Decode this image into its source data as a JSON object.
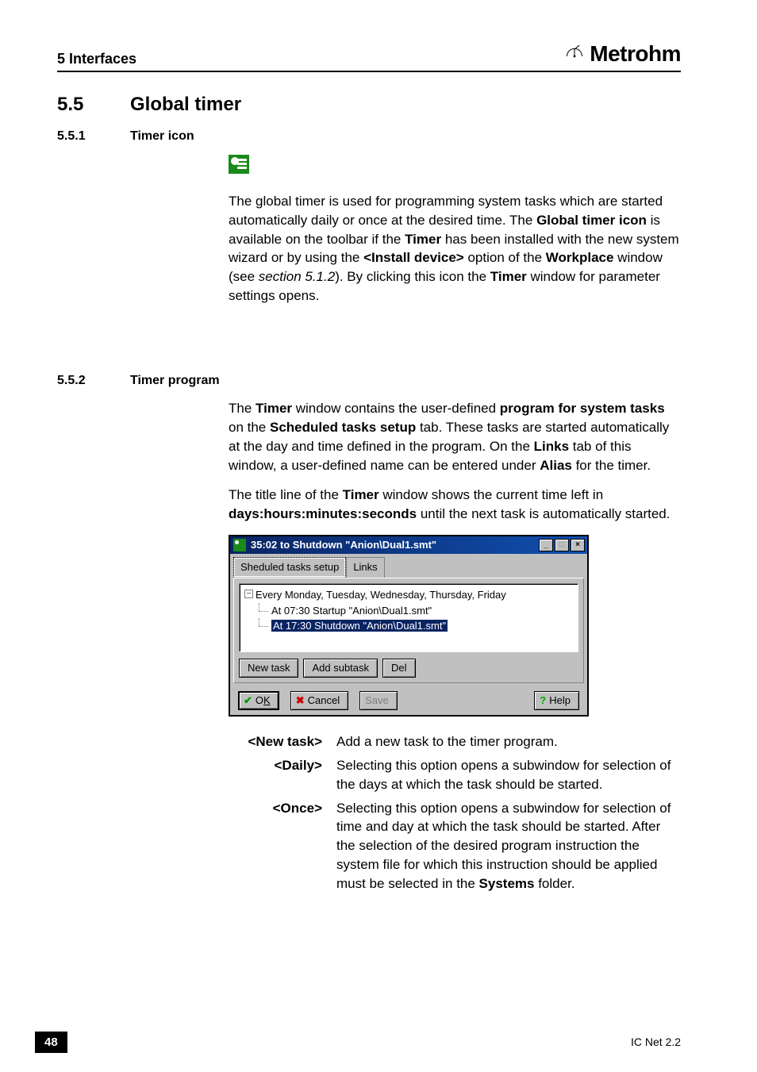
{
  "header": {
    "chapter": "5  Interfaces",
    "brand": "Metrohm"
  },
  "sec": {
    "num": "5.5",
    "title": "Global timer"
  },
  "sub1": {
    "num": "5.5.1",
    "title": "Timer icon",
    "p1a": "The global timer is used for programming system tasks which are started automatically daily or once at the desired time. The ",
    "p1b": "Global timer icon",
    "p1c": " is available on the toolbar if the ",
    "p1d": "Timer",
    "p1e": " has been installed with the new system wizard or by using the ",
    "p1f": "<Install device>",
    "p1g": " option of the ",
    "p1h": "Workplace",
    "p1i": " window (see ",
    "p1j": "section 5.1.2",
    "p1k": "). By clicking this icon the ",
    "p1l": "Timer",
    "p1m": " window for parameter settings opens."
  },
  "sub2": {
    "num": "5.5.2",
    "title": "Timer program",
    "p1a": "The ",
    "p1b": "Timer",
    "p1c": " window contains the user-defined ",
    "p1d": "program for system tasks",
    "p1e": " on the ",
    "p1f": "Scheduled tasks setup",
    "p1g": " tab. These tasks are started automatically at the day and time defined in the program. On the ",
    "p1h": "Links",
    "p1i": " tab of this window, a user-defined name can be entered under ",
    "p1j": "Alias",
    "p1k": " for the timer.",
    "p2a": "The title line of the ",
    "p2b": "Timer",
    "p2c": " window shows the current time left in ",
    "p2d": "days:hours:minutes:seconds",
    "p2e": " until the next task is automatically started."
  },
  "win": {
    "title": "35:02 to Shutdown \"Anion\\Dual1.smt\"",
    "tab1": "Sheduled tasks setup",
    "tab2": "Links",
    "tree_root": "Every Monday, Tuesday, Wednesday, Thursday, Friday",
    "tree_c1": "At 07:30 Startup \"Anion\\Dual1.smt\"",
    "tree_c2": "At 17:30 Shutdown \"Anion\\Dual1.smt\"",
    "btn_new": "New task",
    "btn_sub": "Add subtask",
    "btn_del": "Del",
    "ok_txt": "K",
    "ok_pre": "O",
    "cancel": "Cancel",
    "save": "Save",
    "help": "Help",
    "min": "_",
    "max": "□",
    "close": "×",
    "toggle": "–"
  },
  "dl": {
    "t1": "<New task>",
    "d1": "Add a new task to the timer program.",
    "t2": "<Daily>",
    "d2": "Selecting this option opens a subwindow for selection of the days at which the task should be started.",
    "t3": "<Once>",
    "d3a": "Selecting this option opens a subwindow for selection of time and day at which the task should be started. After the selection of the desired program instruction the system file for which this instruction should be applied must be selected in the ",
    "d3b": "Systems",
    "d3c": " folder."
  },
  "footer": {
    "page": "48",
    "doc": "IC Net 2.2"
  }
}
